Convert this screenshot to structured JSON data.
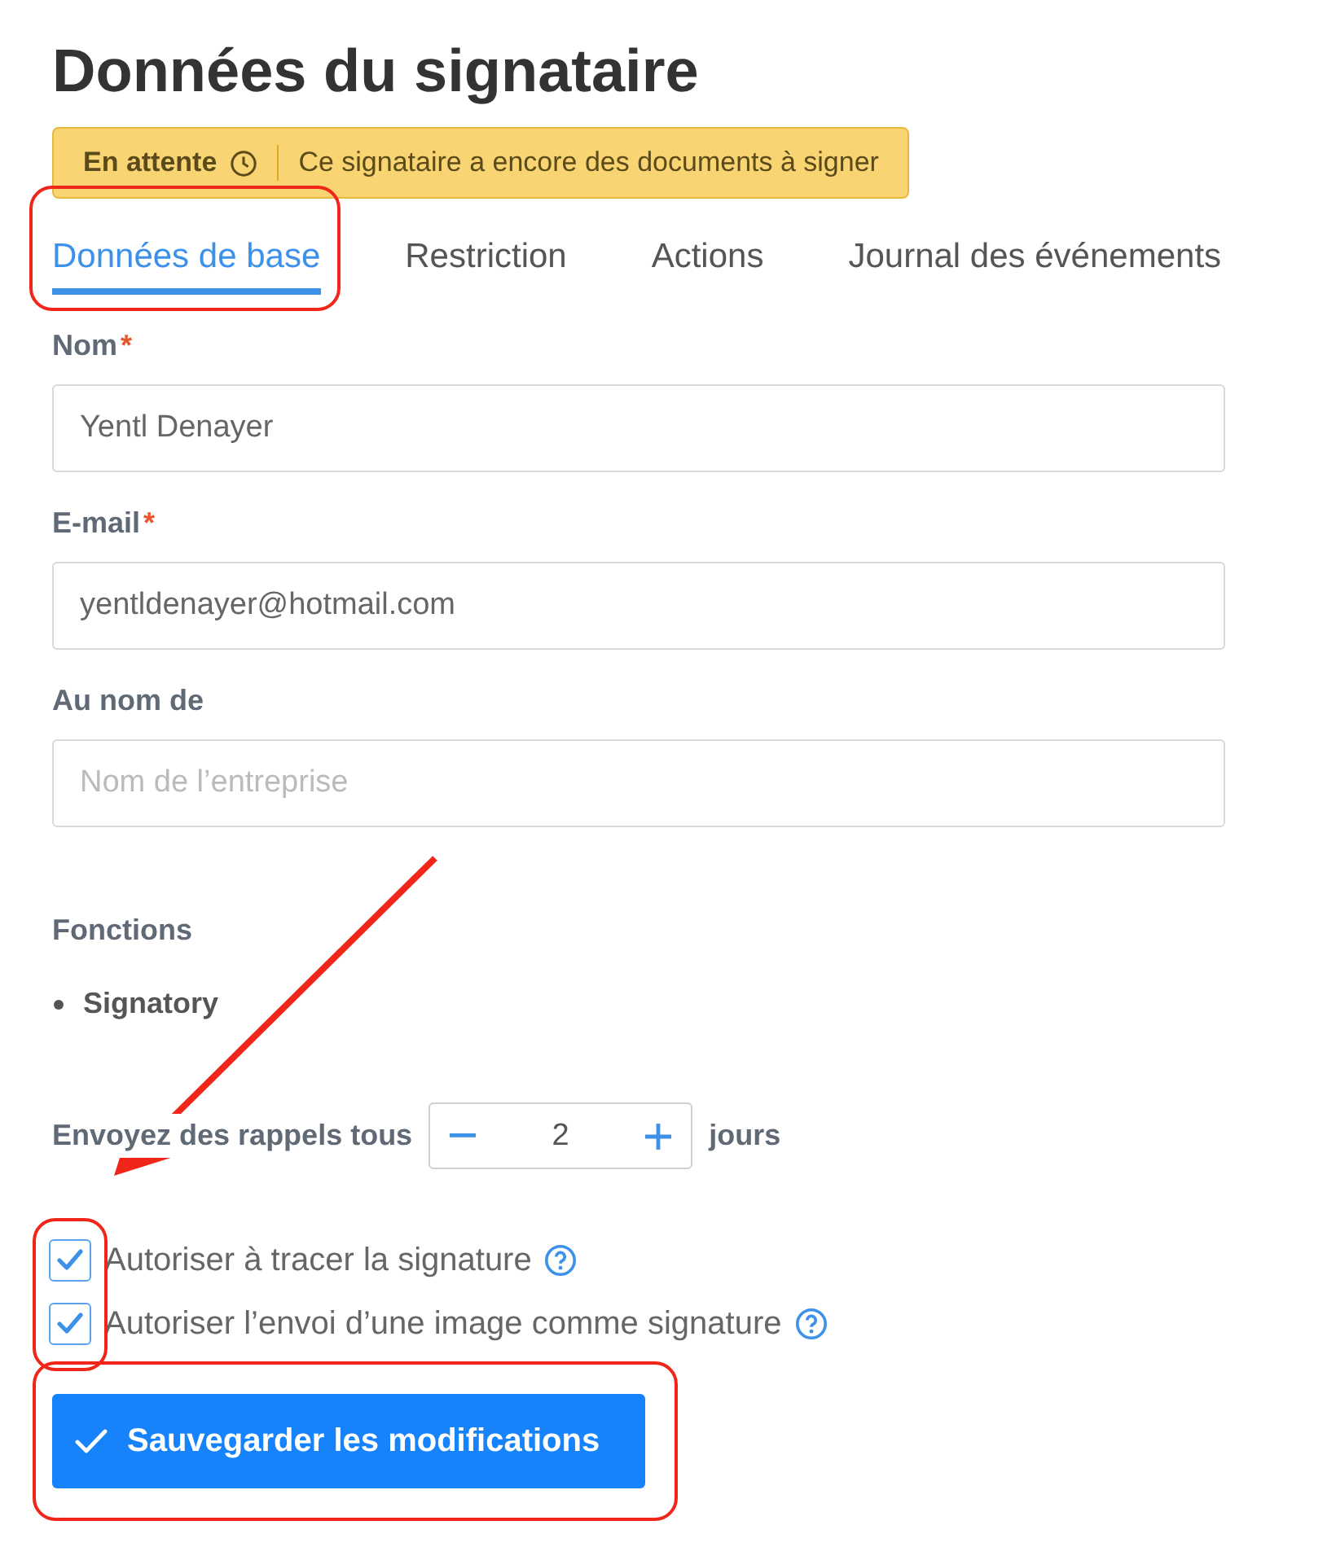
{
  "title": "Données du signataire",
  "status": {
    "label": "En attente",
    "message": "Ce signataire a encore des documents à signer"
  },
  "tabs": [
    {
      "label": "Données de base",
      "selected": true,
      "highlighted": true
    },
    {
      "label": "Restriction",
      "selected": false,
      "highlighted": false
    },
    {
      "label": "Actions",
      "selected": false,
      "highlighted": false
    },
    {
      "label": "Journal des événements",
      "selected": false,
      "highlighted": false
    }
  ],
  "fields": [
    {
      "label": "Nom",
      "required_mark": "*",
      "value": "Yentl Denayer"
    },
    {
      "label": "E-mail",
      "required_mark": "*",
      "value": "yentldenayer@hotmail.com"
    },
    {
      "label": "Au nom de",
      "placeholder": "Nom de l’entreprise"
    }
  ],
  "functions": {
    "label": "Fonctions",
    "items": [
      "Signatory"
    ]
  },
  "reminder": {
    "label": "Envoyez des rappels tous",
    "value": "2",
    "unit": "jours"
  },
  "options": {
    "highlighted": true,
    "items": [
      {
        "label": "Autoriser à tracer la signature",
        "checked": true
      },
      {
        "label": "Autoriser l’envoi d’une image comme signature",
        "checked": true
      }
    ]
  },
  "save_button": {
    "label": "Sauvegarder les modifications",
    "highlighted": true
  },
  "annotation_arrow": true
}
